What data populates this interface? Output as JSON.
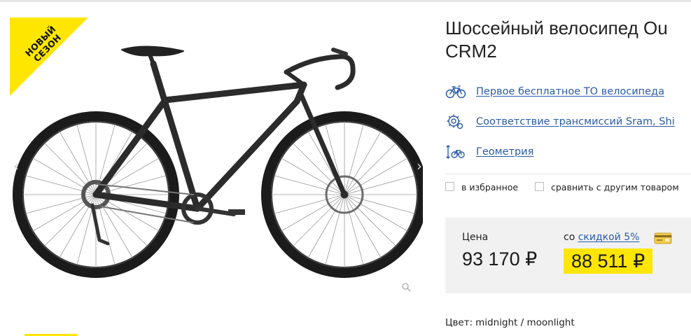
{
  "gallery": {
    "badge": {
      "line1": "НОВЫЙ",
      "line2": "СЕЗОН"
    },
    "prev_arrow": "‹",
    "next_arrow": "›"
  },
  "product": {
    "title_line1": "Шоссейный велосипед Ou",
    "title_line2": "CRM2"
  },
  "features": [
    {
      "icon": "bicycle-icon",
      "label": "Первое бесплатное ТО велосипеда"
    },
    {
      "icon": "gear-icon",
      "label": "Соответствие трансмиссий Sram, Shi"
    },
    {
      "icon": "geometry-icon",
      "label": "Геометрия"
    }
  ],
  "actions": {
    "favorite_label": "в избранное",
    "compare_label": "сравнить с другим товаром"
  },
  "price": {
    "label": "Цена",
    "value": "93 170 ₽",
    "discount_prefix": "со",
    "discount_link": "скидкой 5%",
    "discount_value": "88 511 ₽"
  },
  "color": {
    "label": "Цвет:",
    "value": "midnight / moonlight"
  },
  "colors": {
    "accent_yellow": "#ffe600",
    "link_blue": "#2a5ba8",
    "price_bg": "#f1f1f1"
  }
}
